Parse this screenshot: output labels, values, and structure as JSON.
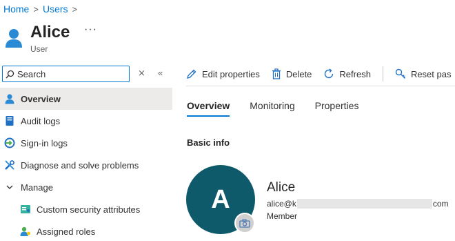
{
  "breadcrumb": {
    "items": [
      "Home",
      "Users"
    ],
    "separator": ">"
  },
  "header": {
    "title": "Alice",
    "more": "···",
    "subtitle": "User"
  },
  "sidebar": {
    "search_placeholder": "Search",
    "clear_glyph": "⨯",
    "collapse_glyph": "«",
    "items": [
      {
        "label": "Overview",
        "icon": "user-icon"
      },
      {
        "label": "Audit logs",
        "icon": "book-icon"
      },
      {
        "label": "Sign-in logs",
        "icon": "signin-icon"
      },
      {
        "label": "Diagnose and solve problems",
        "icon": "wrench-icon"
      },
      {
        "label": "Manage",
        "icon": "chevron-down-icon"
      },
      {
        "label": "Custom security attributes",
        "icon": "attributes-icon"
      },
      {
        "label": "Assigned roles",
        "icon": "roles-icon"
      }
    ]
  },
  "toolbar": {
    "edit": "Edit properties",
    "delete": "Delete",
    "refresh": "Refresh",
    "reset": "Reset pas"
  },
  "tabs": [
    "Overview",
    "Monitoring",
    "Properties"
  ],
  "section_title": "Basic info",
  "profile": {
    "initial": "A",
    "name": "Alice",
    "email_prefix": "alice@k",
    "email_suffix": "com",
    "type": "Member"
  },
  "colors": {
    "accent": "#0078d4",
    "avatar": "#0e5a6b"
  }
}
